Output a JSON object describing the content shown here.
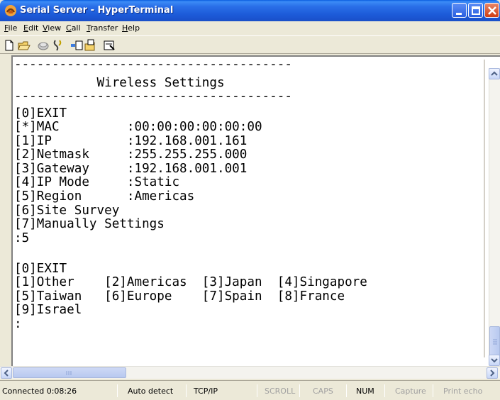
{
  "window": {
    "title": "Serial Server - HyperTerminal",
    "icon": "hyperterminal-phone-icon"
  },
  "menubar": {
    "items": [
      {
        "accel": "F",
        "rest": "ile"
      },
      {
        "accel": "E",
        "rest": "dit"
      },
      {
        "accel": "V",
        "rest": "iew"
      },
      {
        "accel": "C",
        "rest": "all"
      },
      {
        "accel": "T",
        "rest": "ransfer"
      },
      {
        "accel": "H",
        "rest": "elp"
      }
    ]
  },
  "toolbar": {
    "icons": [
      "new-icon",
      "open-icon",
      "connect-icon",
      "disconnect-icon",
      "send-icon",
      "receive-icon",
      "properties-icon"
    ]
  },
  "terminal": {
    "lines": [
      "-------------------------------------",
      "           Wireless Settings",
      "-------------------------------------",
      "[0]EXIT",
      "[*]MAC         :00:00:00:00:00:00",
      "[1]IP          :192.168.001.161",
      "[2]Netmask     :255.255.255.000",
      "[3]Gateway     :192.168.001.001",
      "[4]IP Mode     :Static",
      "[5]Region      :Americas",
      "[6]Site Survey",
      "[7]Manually Settings",
      ":5",
      "",
      "[0]EXIT",
      "[1]Other    [2]Americas  [3]Japan  [4]Singapore",
      "[5]Taiwan   [6]Europe    [7]Spain  [8]France",
      "[9]Israel",
      ":"
    ]
  },
  "statusbar": {
    "connected": "Connected 0:08:26",
    "detect": "Auto detect",
    "protocol": "TCP/IP",
    "scroll": "SCROLL",
    "caps": "CAPS",
    "num": "NUM",
    "capture": "Capture",
    "print_echo": "Print echo"
  }
}
